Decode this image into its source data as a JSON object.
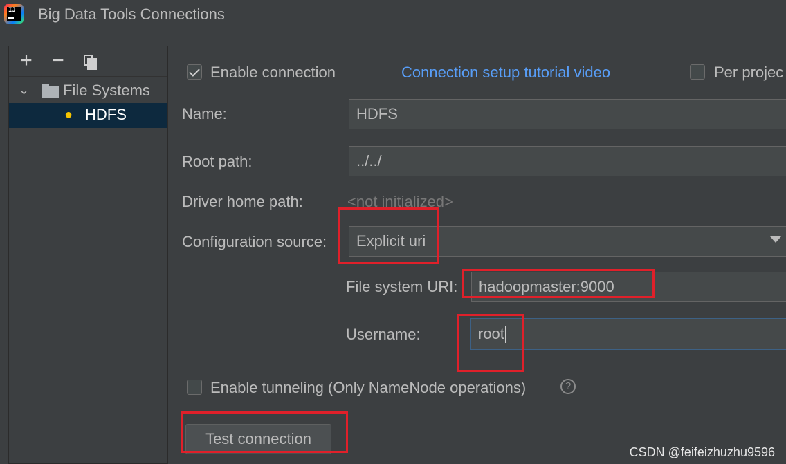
{
  "window": {
    "title": "Big Data Tools Connections",
    "app_icon_text": "IJ"
  },
  "toolbar": {
    "add_icon": "+",
    "remove_icon": "−"
  },
  "tree": {
    "group_label": "File Systems",
    "selected_item": "HDFS",
    "chevron": "⌄"
  },
  "form": {
    "enable_connection_label": "Enable connection",
    "enable_connection_checked": true,
    "tutorial_link": "Connection setup tutorial video",
    "per_project_label": "Per projec",
    "name_label": "Name:",
    "name_value": "HDFS",
    "root_path_label": "Root path:",
    "root_path_value": "../../",
    "driver_home_label": "Driver home path:",
    "driver_home_value": "<not initialized>",
    "config_source_label": "Configuration source:",
    "config_source_value": "Explicit uri",
    "fs_uri_label": "File system URI:",
    "fs_uri_value": "hadoopmaster:9000",
    "username_label": "Username:",
    "username_value": "root",
    "tunneling_label": "Enable tunneling (Only NameNode operations)",
    "help_icon": "?",
    "test_button": "Test connection"
  },
  "watermark": "CSDN @feifeizhuzhu9596"
}
